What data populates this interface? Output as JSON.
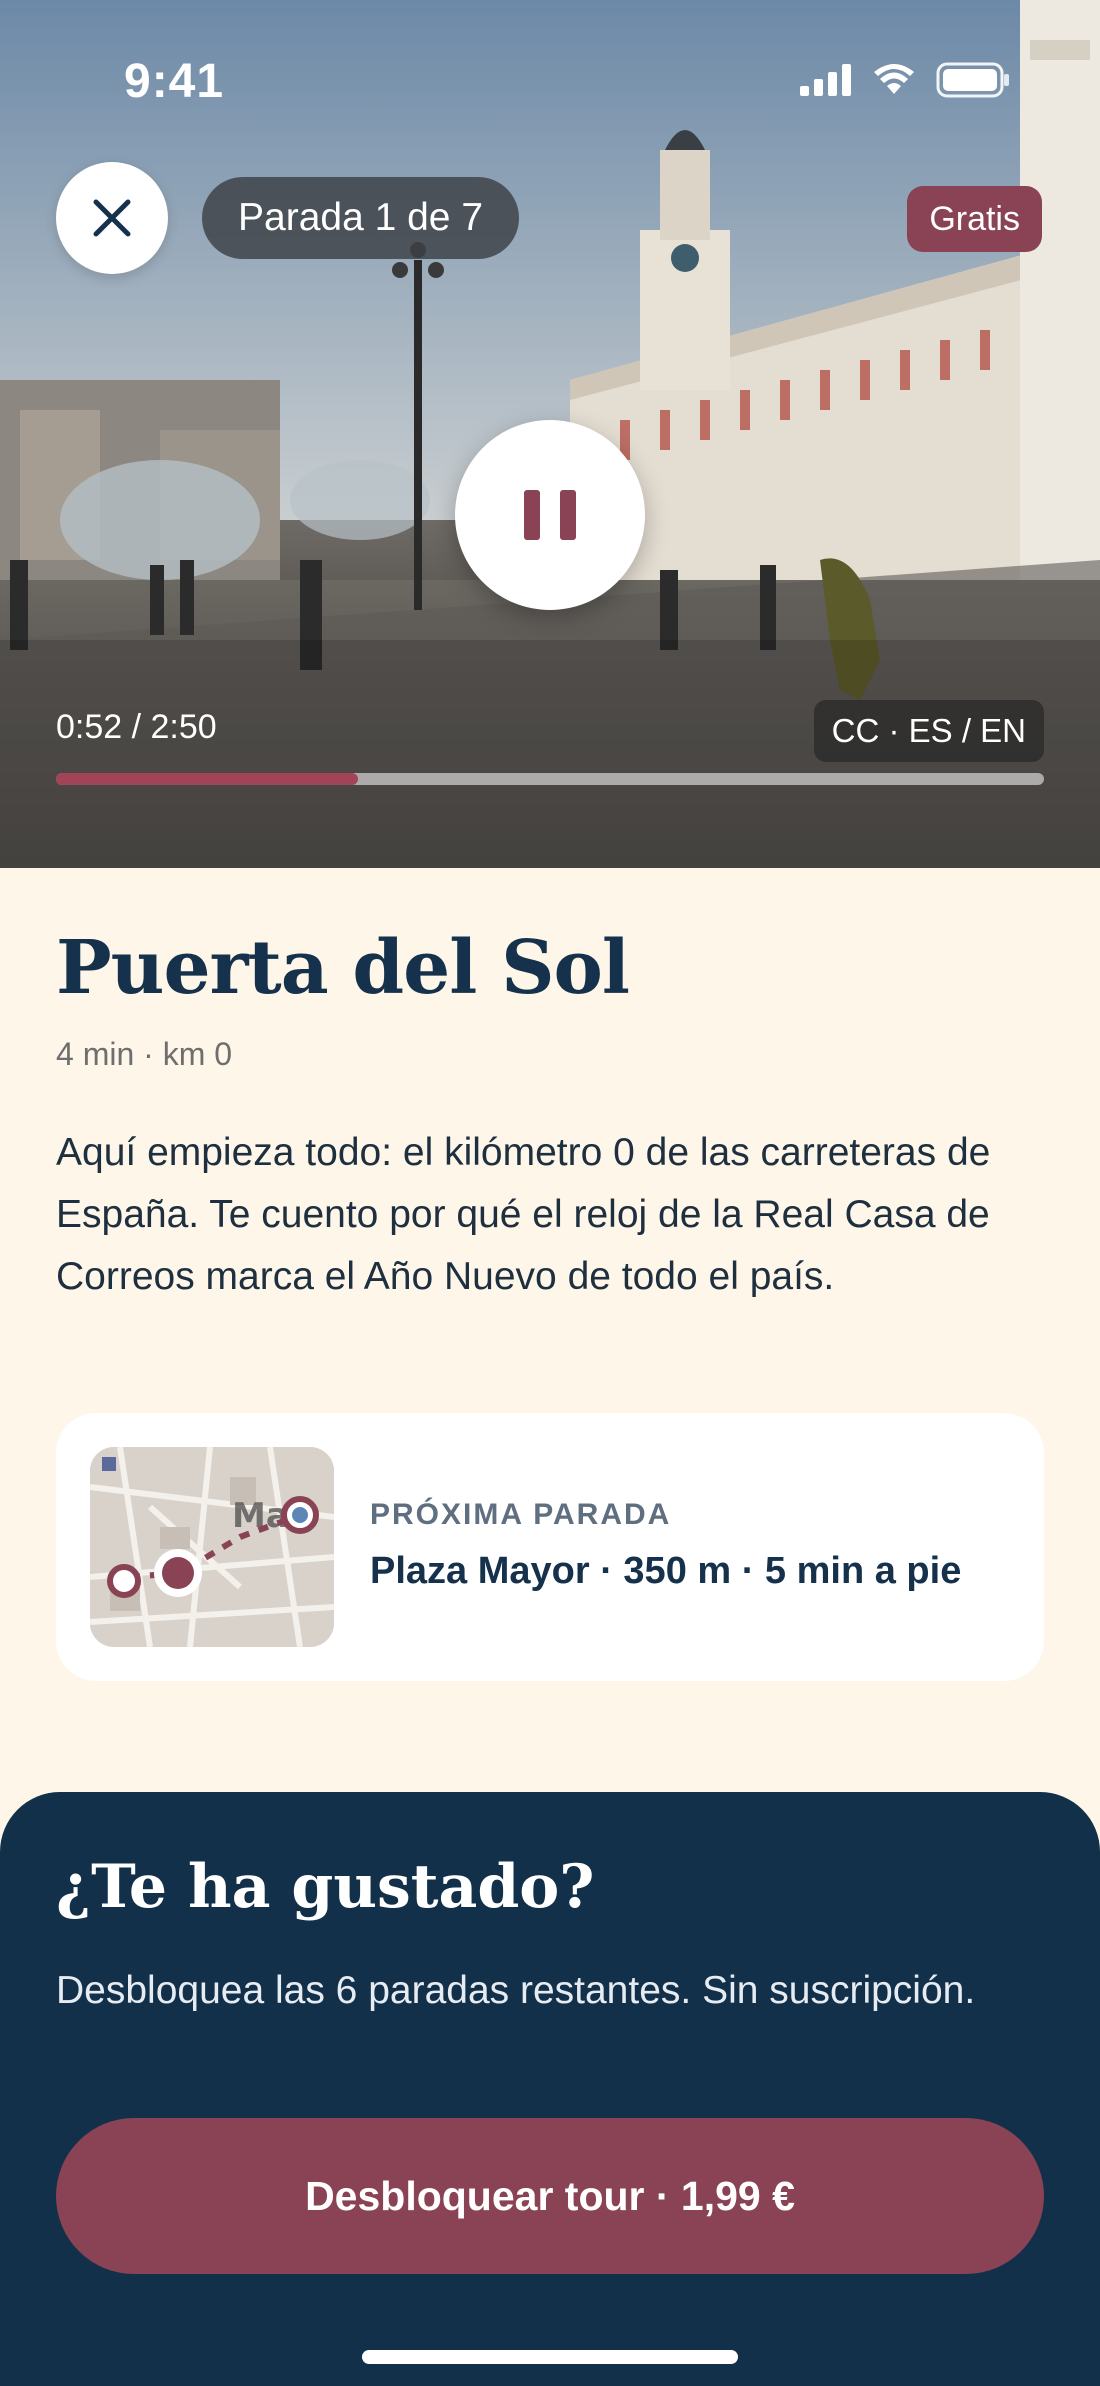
{
  "status_bar": {
    "time": "9:41"
  },
  "player": {
    "stop_label": "Parada 1 de 7",
    "badge": "Gratis",
    "time": "0:52 / 2:50",
    "captions": "CC · ES / EN",
    "progress": 0.306
  },
  "stop": {
    "title": "Puerta del Sol",
    "meta": "4 min · km 0",
    "description": "Aquí empieza todo: el kilómetro 0 de las carreteras de España. Te cuento por qué el reloj de la Real Casa de Correos marca el Año Nuevo de todo el país."
  },
  "next_stop": {
    "label": "PRÓXIMA PARADA",
    "value": "Plaza Mayor · 350 m · 5 min a pie"
  },
  "upsell": {
    "title": "¿Te ha gustado?",
    "text": "Desbloquea las 6 paradas restantes. Sin suscripción.",
    "button": "Desbloquear tour · 1,99 €"
  },
  "colors": {
    "accent": "#8A4354",
    "navy": "#12304A",
    "cream": "#FDF6E9"
  },
  "icons": {
    "close": "close-icon",
    "pause": "pause-icon",
    "signal": "cellular-signal-icon",
    "wifi": "wifi-icon",
    "battery": "battery-icon"
  }
}
